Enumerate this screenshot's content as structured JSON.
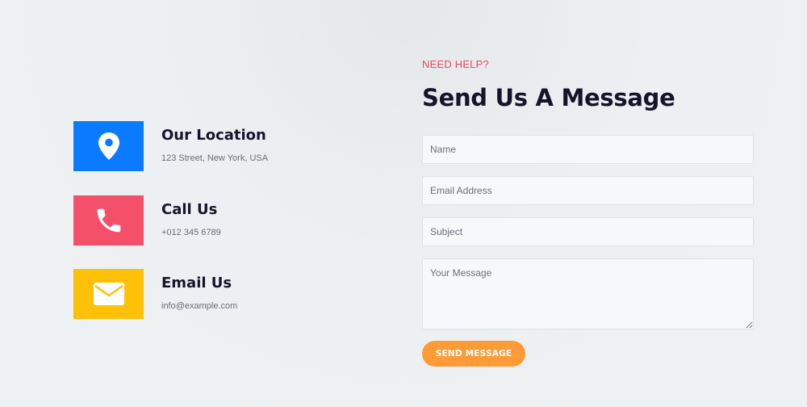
{
  "contact": {
    "items": [
      {
        "icon": "map-pin-icon",
        "color": "#0a7bff",
        "title": "Our Location",
        "text": "123 Street, New York, USA"
      },
      {
        "icon": "phone-icon",
        "color": "#f5506a",
        "title": "Call Us",
        "text": "+012 345 6789"
      },
      {
        "icon": "envelope-icon",
        "color": "#ffc107",
        "title": "Email Us",
        "text": "info@example.com"
      }
    ]
  },
  "form": {
    "eyebrow": "NEED HELP?",
    "heading": "Send Us A Message",
    "name_placeholder": "Name",
    "email_placeholder": "Email Address",
    "subject_placeholder": "Subject",
    "message_placeholder": "Your Message",
    "submit_label": "SEND MESSAGE"
  },
  "colors": {
    "accent_red": "#f3455a",
    "button_orange": "#fe9b36",
    "heading_dark": "#14142b"
  }
}
